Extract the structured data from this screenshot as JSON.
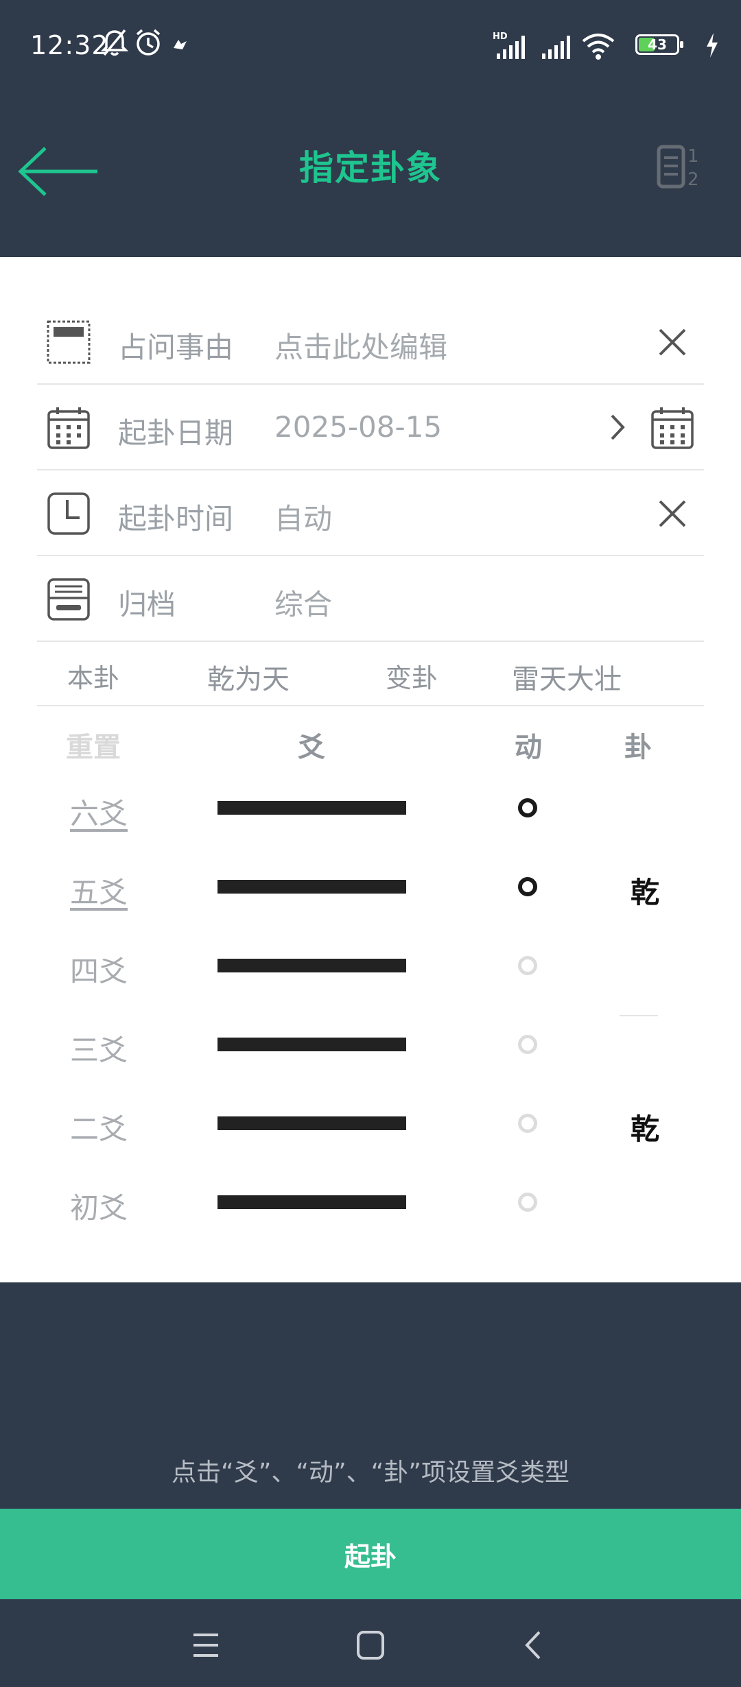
{
  "status_bar": {
    "time": "12:32",
    "battery": "43",
    "icons": [
      "bell-off-icon",
      "alarm-icon",
      "app-notification-icon",
      "hd-signal-icon",
      "signal-icon",
      "wifi-icon",
      "battery-icon",
      "charging-icon"
    ]
  },
  "header": {
    "title": "指定卦象",
    "back_icon": "arrow-left-icon",
    "layout_icon": "document-number-icon"
  },
  "form": {
    "reason": {
      "label": "占问事由",
      "value": "点击此处编辑"
    },
    "date": {
      "label": "起卦日期",
      "value": "2025-08-15"
    },
    "time": {
      "label": "起卦时间",
      "value": "自动"
    },
    "archive": {
      "label": "归档",
      "value": "综合"
    }
  },
  "gua": {
    "ben_label": "本卦",
    "ben_value": "乾为天",
    "bian_label": "变卦",
    "bian_value": "雷天大壮"
  },
  "yao_table": {
    "headers": {
      "reset": "重置",
      "yao": "爻",
      "dong": "动",
      "gua": "卦"
    },
    "rows": [
      {
        "name": "六爻",
        "line": "yang",
        "moving": true
      },
      {
        "name": "五爻",
        "line": "yang",
        "moving": true
      },
      {
        "name": "四爻",
        "line": "yang",
        "moving": false
      },
      {
        "name": "三爻",
        "line": "yang",
        "moving": false
      },
      {
        "name": "二爻",
        "line": "yang",
        "moving": false
      },
      {
        "name": "初爻",
        "line": "yang",
        "moving": false
      }
    ],
    "upper_trigram": "乾",
    "lower_trigram": "乾"
  },
  "hint": "点击“爻”、“动”、“卦”项设置爻类型",
  "submit_label": "起卦",
  "colors": {
    "accent": "#1ec58f",
    "button": "#36be90",
    "bar": "#2f3a4b"
  }
}
